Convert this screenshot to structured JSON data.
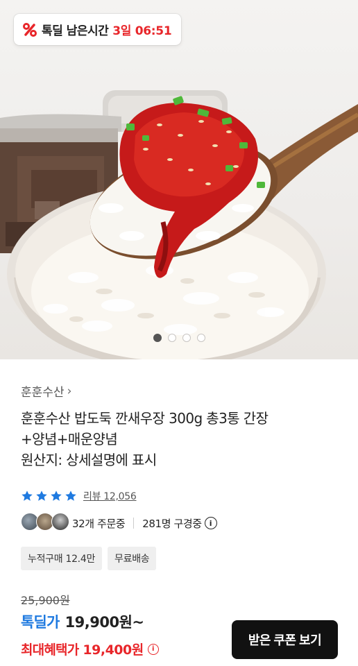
{
  "deal_badge": {
    "label": "톡딜 남은시간",
    "remaining": "3일 06:51"
  },
  "carousel": {
    "total": 4,
    "active": 0
  },
  "product": {
    "seller": "훈훈수산",
    "title_line1": "훈훈수산 밥도둑 깐새우장 300g 총3통 간장",
    "title_line2": "+양념+매운양념",
    "title_line3": "원산지: 상세설명에 표시",
    "rating_stars": 4,
    "review_text": "리뷰 12,056",
    "orders_text": "32개 주문중",
    "watching_text": "281명 구경중",
    "tags": [
      "누적구매 12.4만",
      "무료배송"
    ]
  },
  "price": {
    "original": "25,900원",
    "deal_label": "톡딜가",
    "deal_value": "19,900원~",
    "max_label": "최대혜택가",
    "max_value": "19,400원"
  },
  "coupon_button": "받은 쿠폰 보기",
  "colors": {
    "red": "#e8262a",
    "blue": "#1f7ae0",
    "black": "#111111"
  }
}
